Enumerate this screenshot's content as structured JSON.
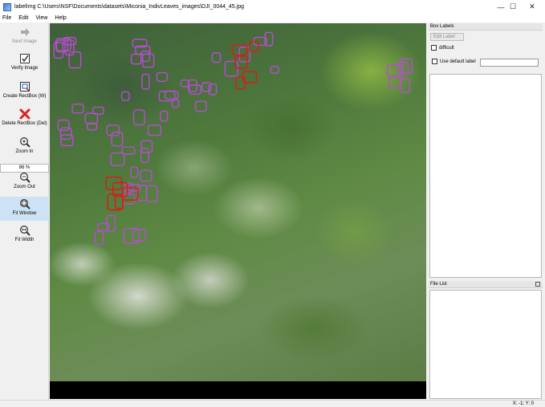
{
  "window": {
    "title": "labelImg C:\\Users\\NSF\\Documents\\datasets\\Miconia_IndivLeaves_images\\DJI_0044_45.jpg",
    "controls": {
      "minimize": "—",
      "maximize": "☐",
      "close": "✕"
    }
  },
  "menu": [
    "File",
    "Edit",
    "View",
    "Help"
  ],
  "toolbar": {
    "next_image": "Next Image",
    "verify_image": "Verify Image",
    "create_rectbox": "Create RectBox (W)",
    "delete_rectbox": "Delete RectBox (Del)",
    "zoom_in": "Zoom In",
    "zoom_value": "86 %",
    "zoom_out": "Zoom Out",
    "fit_window": "Fit Window",
    "fit_width": "Fit Width"
  },
  "box_labels": {
    "title": "Box Labels",
    "edit_label": "Edit Label",
    "difficult": "difficult",
    "use_default_label": "Use default label",
    "default_label_value": ""
  },
  "file_list": {
    "title": "File List"
  },
  "status": {
    "coords": "X: -1; Y: 0"
  },
  "colors": {
    "box_magenta": "#b94bd6",
    "box_red": "#e01818",
    "active_tool": "#cde3f5"
  },
  "annotations": {
    "magenta_count": 62,
    "red_count": 10
  }
}
